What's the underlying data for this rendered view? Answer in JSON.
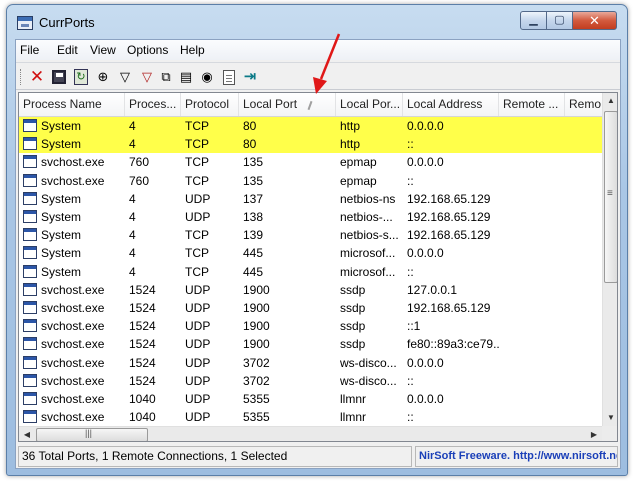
{
  "window": {
    "title": "CurrPorts"
  },
  "menu": [
    "File",
    "Edit",
    "View",
    "Options",
    "Help"
  ],
  "colors": {
    "selected_row": "#ffff4a",
    "annotation_arrow": "#e01818",
    "status_link": "#1a3fb8"
  },
  "toolbar_icons": [
    "delete-x-icon",
    "save-icon",
    "refresh-icon",
    "network-icon",
    "filter-icon",
    "filter-remove-icon",
    "copy-icon",
    "properties-icon",
    "find-binoculars-icon",
    "html-report-icon",
    "exit-icon"
  ],
  "table": {
    "columns": [
      "Process Name",
      "Proces...",
      "Protocol",
      "Local Port",
      "Local Por...",
      "Local Address",
      "Remote ...",
      "Remo"
    ],
    "rows": [
      {
        "selected": true,
        "cells": [
          "System",
          "4",
          "TCP",
          "80",
          "http",
          "0.0.0.0",
          "",
          ""
        ]
      },
      {
        "selected": true,
        "cells": [
          "System",
          "4",
          "TCP",
          "80",
          "http",
          "::",
          "",
          ""
        ]
      },
      {
        "selected": false,
        "cells": [
          "svchost.exe",
          "760",
          "TCP",
          "135",
          "epmap",
          "0.0.0.0",
          "",
          ""
        ]
      },
      {
        "selected": false,
        "cells": [
          "svchost.exe",
          "760",
          "TCP",
          "135",
          "epmap",
          "::",
          "",
          ""
        ]
      },
      {
        "selected": false,
        "cells": [
          "System",
          "4",
          "UDP",
          "137",
          "netbios-ns",
          "192.168.65.129",
          "",
          ""
        ]
      },
      {
        "selected": false,
        "cells": [
          "System",
          "4",
          "UDP",
          "138",
          "netbios-...",
          "192.168.65.129",
          "",
          ""
        ]
      },
      {
        "selected": false,
        "cells": [
          "System",
          "4",
          "TCP",
          "139",
          "netbios-s...",
          "192.168.65.129",
          "",
          ""
        ]
      },
      {
        "selected": false,
        "cells": [
          "System",
          "4",
          "TCP",
          "445",
          "microsof...",
          "0.0.0.0",
          "",
          ""
        ]
      },
      {
        "selected": false,
        "cells": [
          "System",
          "4",
          "TCP",
          "445",
          "microsof...",
          "::",
          "",
          ""
        ]
      },
      {
        "selected": false,
        "cells": [
          "svchost.exe",
          "1524",
          "UDP",
          "1900",
          "ssdp",
          "127.0.0.1",
          "",
          ""
        ]
      },
      {
        "selected": false,
        "cells": [
          "svchost.exe",
          "1524",
          "UDP",
          "1900",
          "ssdp",
          "192.168.65.129",
          "",
          ""
        ]
      },
      {
        "selected": false,
        "cells": [
          "svchost.exe",
          "1524",
          "UDP",
          "1900",
          "ssdp",
          "::1",
          "",
          ""
        ]
      },
      {
        "selected": false,
        "cells": [
          "svchost.exe",
          "1524",
          "UDP",
          "1900",
          "ssdp",
          "fe80::89a3:ce79...",
          "",
          ""
        ]
      },
      {
        "selected": false,
        "cells": [
          "svchost.exe",
          "1524",
          "UDP",
          "3702",
          "ws-disco...",
          "0.0.0.0",
          "",
          ""
        ]
      },
      {
        "selected": false,
        "cells": [
          "svchost.exe",
          "1524",
          "UDP",
          "3702",
          "ws-disco...",
          "::",
          "",
          ""
        ]
      },
      {
        "selected": false,
        "cells": [
          "svchost.exe",
          "1040",
          "UDP",
          "5355",
          "llmnr",
          "0.0.0.0",
          "",
          ""
        ]
      },
      {
        "selected": false,
        "cells": [
          "svchost.exe",
          "1040",
          "UDP",
          "5355",
          "llmnr",
          "::",
          "",
          ""
        ]
      }
    ]
  },
  "status": {
    "summary": "36 Total Ports, 1 Remote Connections, 1 Selected",
    "link": "NirSoft Freeware.  http://www.nirsoft.ne"
  }
}
